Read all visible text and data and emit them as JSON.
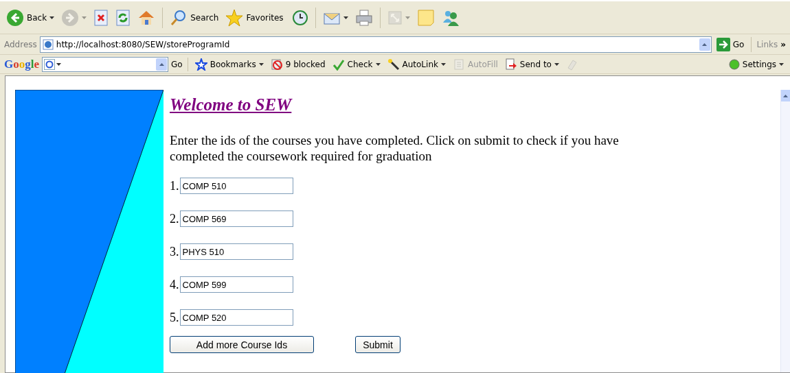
{
  "toolbar": {
    "items": [
      {
        "kind": "back",
        "label": "Back",
        "caret": true,
        "disabled": false
      },
      {
        "kind": "forward",
        "caret": true,
        "disabled": true
      },
      {
        "kind": "stop",
        "caret": false,
        "disabled": false
      },
      {
        "kind": "refresh",
        "caret": false,
        "disabled": false
      },
      {
        "kind": "home",
        "caret": false,
        "disabled": false
      },
      {
        "kind": "search",
        "label": "Search",
        "caret": false,
        "disabled": false
      },
      {
        "kind": "favorites",
        "label": "Favorites",
        "caret": false,
        "disabled": false
      },
      {
        "kind": "history",
        "caret": false,
        "disabled": false
      },
      {
        "kind": "mail",
        "caret": true,
        "disabled": false
      },
      {
        "kind": "print",
        "caret": false,
        "disabled": false
      },
      {
        "kind": "edit",
        "caret": true,
        "disabled": true
      },
      {
        "kind": "note",
        "caret": false,
        "disabled": false
      },
      {
        "kind": "messenger",
        "caret": false,
        "disabled": false
      }
    ]
  },
  "address_bar": {
    "label": "Address",
    "url": "http://localhost:8080/SEW/storeProgramId",
    "go": "Go",
    "links": "Links",
    "more": "»"
  },
  "google_bar": {
    "logo": "Google",
    "go": "Go",
    "items": [
      {
        "kind": "bookmarks",
        "label": "Bookmarks",
        "caret": true,
        "disabled": false
      },
      {
        "kind": "blocked",
        "label": "9 blocked",
        "caret": false,
        "disabled": false
      },
      {
        "kind": "check",
        "label": "Check",
        "caret": true,
        "disabled": false
      },
      {
        "kind": "autolink",
        "label": "AutoLink",
        "caret": true,
        "disabled": false
      },
      {
        "kind": "autofill",
        "label": "AutoFill",
        "caret": false,
        "disabled": true
      },
      {
        "kind": "sendto",
        "label": "Send to",
        "caret": true,
        "disabled": false
      },
      {
        "kind": "eraser",
        "caret": false,
        "disabled": true
      }
    ],
    "settings": "Settings"
  },
  "page": {
    "title": "Welcome to SEW",
    "intro": "Enter the ids of the courses you have completed. Click on submit to check if you have completed the coursework required for graduation",
    "courses": [
      {
        "number": "1.",
        "value": "COMP 510"
      },
      {
        "number": "2.",
        "value": "COMP 569"
      },
      {
        "number": "3.",
        "value": "PHYS 510"
      },
      {
        "number": "4.",
        "value": "COMP 599"
      },
      {
        "number": "5.",
        "value": "COMP 520"
      }
    ],
    "buttons": [
      "Add more Course Ids",
      "Submit"
    ]
  }
}
